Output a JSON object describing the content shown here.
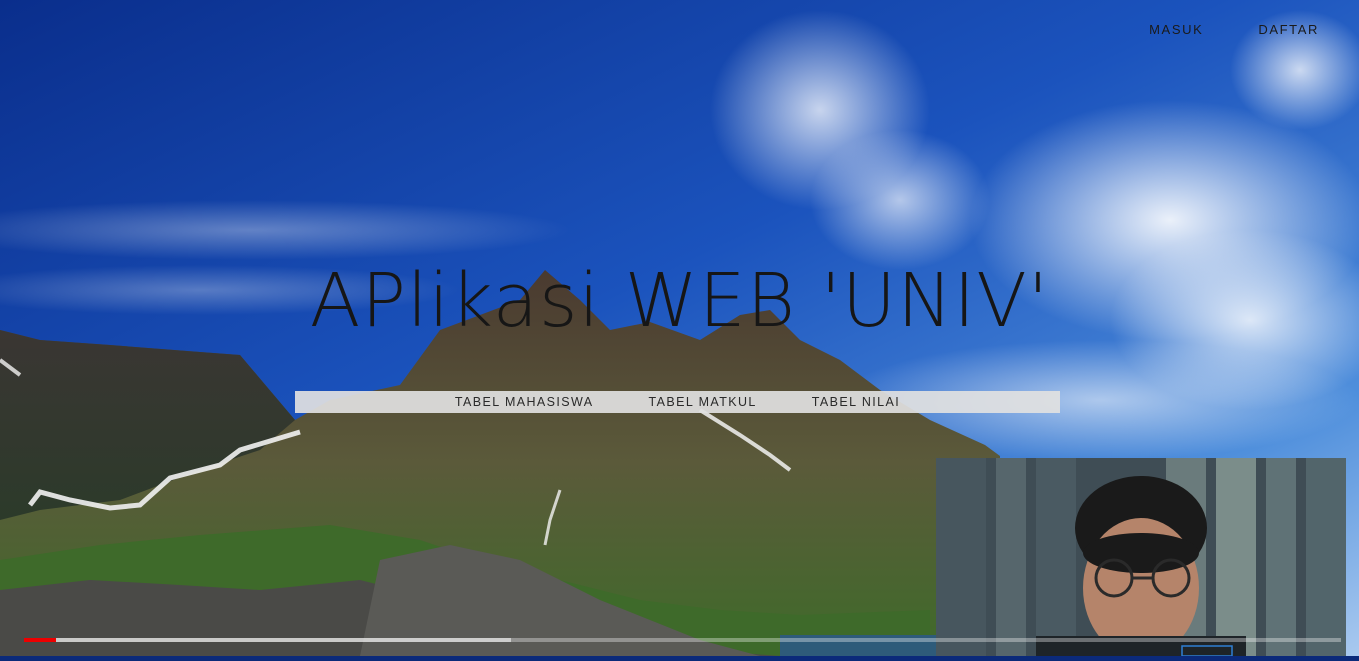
{
  "nav": {
    "login": "MASUK",
    "register": "DAFTAR"
  },
  "hero": {
    "title": "APlikasi WEB 'UNIV'"
  },
  "menu": {
    "items": [
      "TABEL MAHASISWA",
      "TABEL MATKUL",
      "TABEL NILAI"
    ]
  },
  "video": {
    "progress": 0.024,
    "loaded": 0.37
  },
  "colors": {
    "sky_top": "#0a2a8a",
    "sky_mid": "#1f5fc4",
    "progress": "#ee0000",
    "menu_bg": "#e1e1e1"
  }
}
